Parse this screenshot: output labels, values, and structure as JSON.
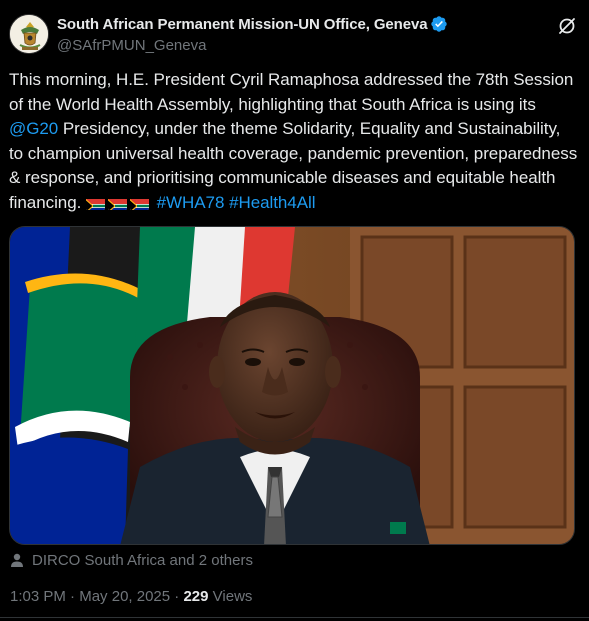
{
  "account": {
    "display_name": "South African Permanent Mission-UN Office, Geneva",
    "handle": "@SAfrPMUN_Geneva",
    "verified": true,
    "avatar_icon": "coat-of-arms-icon"
  },
  "tweet": {
    "text_before_mention": "This morning, H.E. President Cyril Ramaphosa addressed the 78th Session of the World Health Assembly, highlighting that South Africa is using its ",
    "mention": "@G20",
    "text_after_mention": " Presidency, under the theme Solidarity, Equality and Sustainability, to champion universal health coverage, pandemic prevention, preparedness & response, and prioritising communicable diseases and equitable health financing. ",
    "flag_emojis": [
      "south-africa-flag-icon",
      "south-africa-flag-icon",
      "south-africa-flag-icon"
    ],
    "hashtags": [
      "#WHA78",
      "#Health4All"
    ]
  },
  "tagged_people": "DIRCO South Africa and 2 others",
  "meta": {
    "time": "1:03 PM",
    "separator": "·",
    "date": "May 20, 2025",
    "views_count": "229",
    "views_label": "Views"
  },
  "colors": {
    "background": "#000000",
    "text": "#e7e9ea",
    "secondary": "#71767b",
    "link": "#1d9bf0",
    "verified": "#1d9bf0"
  }
}
